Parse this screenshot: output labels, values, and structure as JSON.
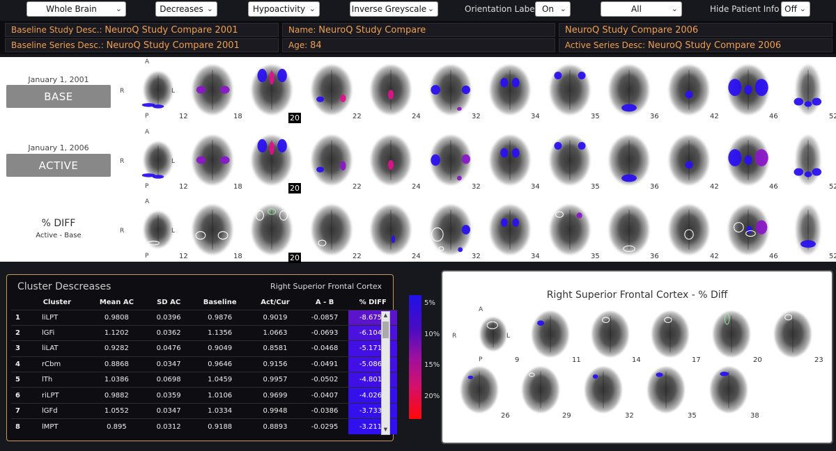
{
  "toolbar": {
    "region": "Whole Brain",
    "direction": "Decreases",
    "mode": "Hypoactivity",
    "colormap": "Inverse Greyscale",
    "orientation_label": "Orientation Labels",
    "orientation_value": "On",
    "filter": "All",
    "hide_patient_label": "Hide Patient Info",
    "hide_patient_value": "Off"
  },
  "info": {
    "baseline_study_label": "Baseline Study Desc.:",
    "baseline_study_value": "NeuroQ Study Compare 2001",
    "baseline_series_label": "Baseline Series Desc.:",
    "baseline_series_value": "NeuroQ Study Compare 2001",
    "name_label": "Name:",
    "name_value": "NeuroQ Study Compare",
    "age_label": "Age:",
    "age_value": "84",
    "active_study_value": "NeuroQ Study Compare 2006",
    "active_series_label": "Active Series Desc:",
    "active_series_value": "NeuroQ Study Compare 2006"
  },
  "rows": {
    "base_date": "January 1, 2001",
    "base_button": "BASE",
    "active_date": "January 1, 2006",
    "active_button": "ACTIVE",
    "diff_title": "% DIFF",
    "diff_sub": "Active - Base"
  },
  "orientation": {
    "a": "A",
    "p": "P",
    "r": "R",
    "l": "L"
  },
  "slices": [
    "12",
    "18",
    "20",
    "22",
    "24",
    "32",
    "34",
    "35",
    "36",
    "42",
    "46",
    "52"
  ],
  "cluster": {
    "title": "Cluster Descreases",
    "subtitle": "Right Superior Frontal Cortex",
    "headers": [
      "Cluster",
      "Mean AC",
      "SD AC",
      "Baseline",
      "Act/Cur",
      "A - B",
      "% DIFF"
    ],
    "rows": [
      {
        "idx": "1",
        "name": "liLPT",
        "mean": "0.9808",
        "sd": "0.0396",
        "base": "0.9876",
        "act": "0.9019",
        "ab": "-0.0857",
        "pd": "-8.6752",
        "color": "#5b14cc"
      },
      {
        "idx": "2",
        "name": "lGFi",
        "mean": "1.1202",
        "sd": "0.0362",
        "base": "1.1356",
        "act": "1.0663",
        "ab": "-0.0693",
        "pd": "-6.1046",
        "color": "#4a12dc"
      },
      {
        "idx": "3",
        "name": "liLAT",
        "mean": "0.9282",
        "sd": "0.0476",
        "base": "0.9049",
        "act": "0.8581",
        "ab": "-0.0468",
        "pd": "-5.1713",
        "color": "#4210e4"
      },
      {
        "idx": "4",
        "name": "rCbm",
        "mean": "0.8868",
        "sd": "0.0347",
        "base": "0.9646",
        "act": "0.9156",
        "ab": "-0.0491",
        "pd": "-5.0867",
        "color": "#4210e4"
      },
      {
        "idx": "5",
        "name": "lTh",
        "mean": "1.0386",
        "sd": "0.0698",
        "base": "1.0459",
        "act": "0.9957",
        "ab": "-0.0502",
        "pd": "-4.8014",
        "color": "#3e10e6"
      },
      {
        "idx": "6",
        "name": "riLPT",
        "mean": "0.9882",
        "sd": "0.0359",
        "base": "1.0106",
        "act": "0.9699",
        "ab": "-0.0407",
        "pd": "-4.0261",
        "color": "#3610ea"
      },
      {
        "idx": "7",
        "name": "lGFd",
        "mean": "1.0552",
        "sd": "0.0347",
        "base": "1.0334",
        "act": "0.9948",
        "ab": "-0.0386",
        "pd": "-3.7334",
        "color": "#3410ec"
      },
      {
        "idx": "8",
        "name": "lMPT",
        "mean": "0.895",
        "sd": "0.0312",
        "base": "0.9188",
        "act": "0.8893",
        "ab": "-0.0295",
        "pd": "-3.2119",
        "color": "#3010ee"
      }
    ]
  },
  "colorbar": {
    "ticks": [
      "5%",
      "10%",
      "15%",
      "20%"
    ]
  },
  "detail": {
    "title": "Right Superior Frontal Cortex - % Diff",
    "slices": [
      "9",
      "11",
      "14",
      "17",
      "20",
      "23",
      "26",
      "29",
      "32",
      "35",
      "38"
    ]
  }
}
